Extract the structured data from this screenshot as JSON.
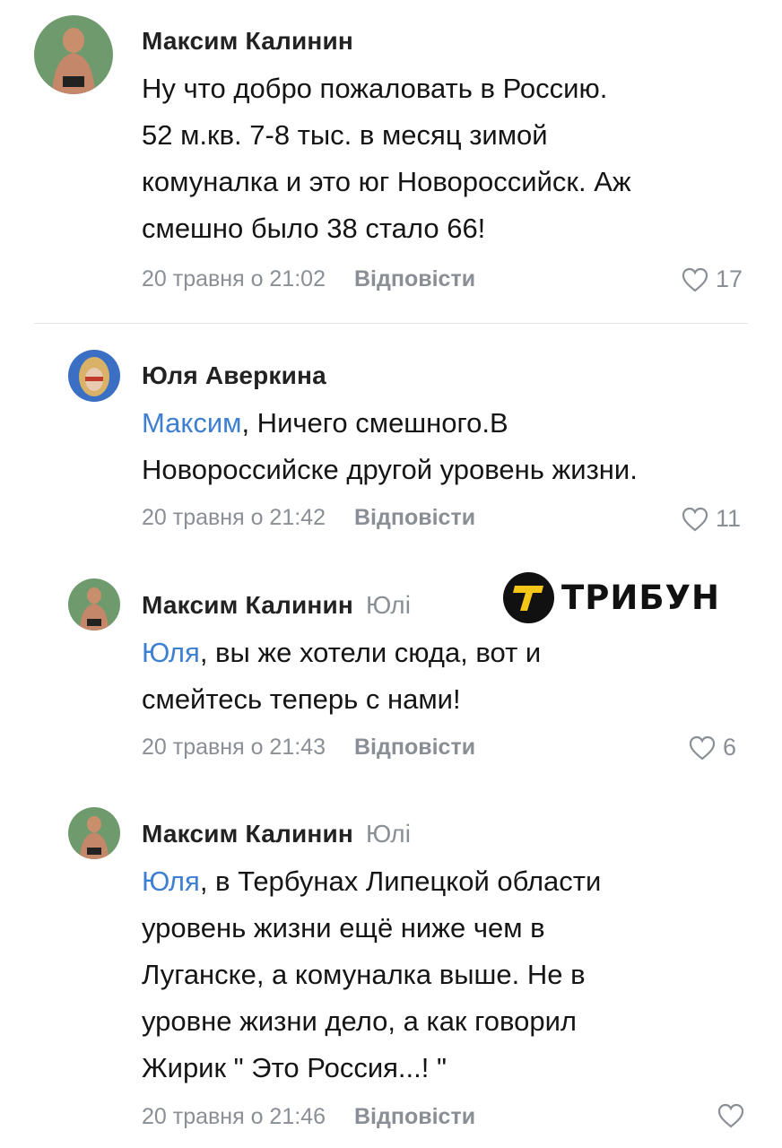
{
  "comments": [
    {
      "author": "Максим Калинин",
      "reply_to": "",
      "mention": "",
      "lines": [
        "Ну что добро пожаловать в Россию.",
        "52 м.кв. 7-8 тыс. в месяц зимой",
        "комуналка и это юг Новороссийск. Аж",
        "смешно было 38 стало 66!"
      ],
      "date": "20 травня о 21:02",
      "reply_label": "Відповісти",
      "likes": "17"
    },
    {
      "author": "Юля Аверкина",
      "reply_to": "",
      "mention": "Максим",
      "lines": [
        ", Ничего смешного.В",
        "Новороссийске другой уровень жизни."
      ],
      "date": "20 травня о 21:42",
      "reply_label": "Відповісти",
      "likes": "11"
    },
    {
      "author": "Максим Калинин",
      "reply_to": "Юлі",
      "mention": "Юля",
      "lines": [
        ", вы же хотели сюда, вот и",
        "смейтесь теперь с нами!"
      ],
      "date": "20 травня о 21:43",
      "reply_label": "Відповісти",
      "likes": "6"
    },
    {
      "author": "Максим Калинин",
      "reply_to": "Юлі",
      "mention": "Юля",
      "lines": [
        ", в Тербунах Липецкой области",
        "уровень жизни ещё ниже чем в",
        "Луганске, а комуналка выше. Не в",
        "уровне жизни дело, а как говорил",
        "Жирик \" Это Россия...! \""
      ],
      "date": "20 травня о 21:46",
      "reply_label": "Відповісти",
      "likes": ""
    }
  ],
  "watermark": {
    "text": "ТРИБУН",
    "letter": "T"
  },
  "colors": {
    "mention": "#3d7fd1",
    "meta": "#8a8f96",
    "text": "#151515"
  },
  "icons": {
    "like": "heart-outline-icon"
  }
}
